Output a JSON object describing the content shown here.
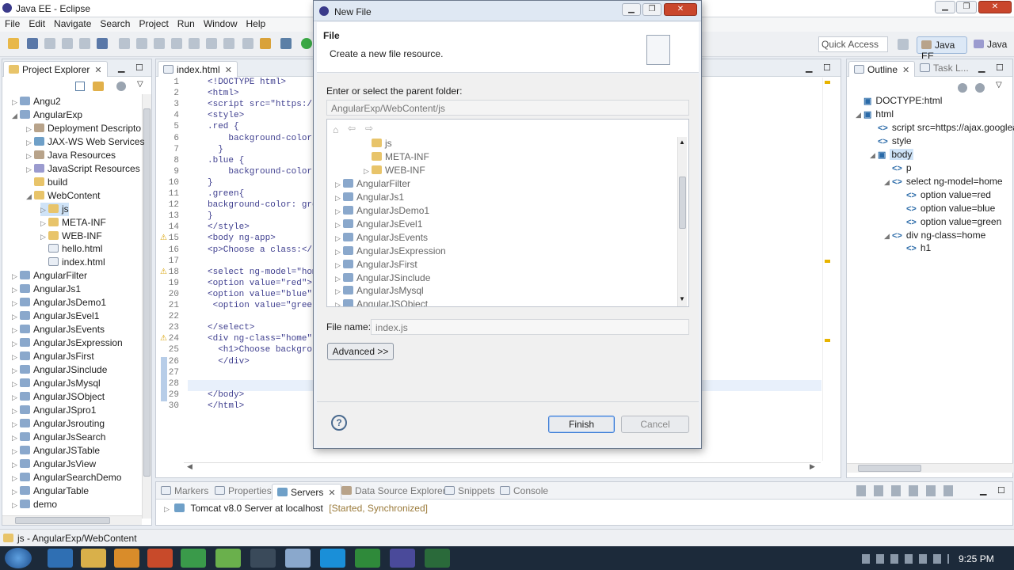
{
  "window": {
    "title": "Java EE - Eclipse"
  },
  "menu": [
    "File",
    "Edit",
    "Navigate",
    "Search",
    "Project",
    "Run",
    "Window",
    "Help"
  ],
  "toolbar": {
    "quick_access": "Quick Access",
    "persp_java_ee": "Java EE",
    "persp_java": "Java"
  },
  "explorer": {
    "tab": "Project Explorer",
    "rows": [
      {
        "label": "Angu2",
        "indent": 0,
        "tw": "▷",
        "icon": "proj"
      },
      {
        "label": "AngularExp",
        "indent": 0,
        "tw": "◢",
        "icon": "proj"
      },
      {
        "label": "Deployment Descripto",
        "indent": 1,
        "tw": "▷",
        "icon": "lib"
      },
      {
        "label": "JAX-WS Web Services",
        "indent": 1,
        "tw": "▷",
        "icon": "ws"
      },
      {
        "label": "Java Resources",
        "indent": 1,
        "tw": "▷",
        "icon": "lib"
      },
      {
        "label": "JavaScript Resources",
        "indent": 1,
        "tw": "▷",
        "icon": "js"
      },
      {
        "label": "build",
        "indent": 1,
        "tw": "",
        "icon": "folder"
      },
      {
        "label": "WebContent",
        "indent": 1,
        "tw": "◢",
        "icon": "folder"
      },
      {
        "label": "js",
        "indent": 2,
        "tw": "▷",
        "icon": "folder",
        "selected": true
      },
      {
        "label": "META-INF",
        "indent": 2,
        "tw": "▷",
        "icon": "folder"
      },
      {
        "label": "WEB-INF",
        "indent": 2,
        "tw": "▷",
        "icon": "folder"
      },
      {
        "label": "hello.html",
        "indent": 2,
        "tw": "",
        "icon": "file"
      },
      {
        "label": "index.html",
        "indent": 2,
        "tw": "",
        "icon": "file"
      },
      {
        "label": "AngularFilter",
        "indent": 0,
        "tw": "▷",
        "icon": "proj"
      },
      {
        "label": "AngularJs1",
        "indent": 0,
        "tw": "▷",
        "icon": "proj"
      },
      {
        "label": "AngularJsDemo1",
        "indent": 0,
        "tw": "▷",
        "icon": "proj"
      },
      {
        "label": "AngularJsEvel1",
        "indent": 0,
        "tw": "▷",
        "icon": "proj"
      },
      {
        "label": "AngularJsEvents",
        "indent": 0,
        "tw": "▷",
        "icon": "proj"
      },
      {
        "label": "AngularJsExpression",
        "indent": 0,
        "tw": "▷",
        "icon": "proj"
      },
      {
        "label": "AngularJsFirst",
        "indent": 0,
        "tw": "▷",
        "icon": "proj"
      },
      {
        "label": "AngularJSinclude",
        "indent": 0,
        "tw": "▷",
        "icon": "proj"
      },
      {
        "label": "AngularJsMysql",
        "indent": 0,
        "tw": "▷",
        "icon": "proj"
      },
      {
        "label": "AngularJSObject",
        "indent": 0,
        "tw": "▷",
        "icon": "proj"
      },
      {
        "label": "AngularJSpro1",
        "indent": 0,
        "tw": "▷",
        "icon": "proj"
      },
      {
        "label": "AngularJsrouting",
        "indent": 0,
        "tw": "▷",
        "icon": "proj"
      },
      {
        "label": "AngularJsSearch",
        "indent": 0,
        "tw": "▷",
        "icon": "proj"
      },
      {
        "label": "AngularJSTable",
        "indent": 0,
        "tw": "▷",
        "icon": "proj"
      },
      {
        "label": "AngularJsView",
        "indent": 0,
        "tw": "▷",
        "icon": "proj"
      },
      {
        "label": "AngularSearchDemo",
        "indent": 0,
        "tw": "▷",
        "icon": "proj"
      },
      {
        "label": "AngularTable",
        "indent": 0,
        "tw": "▷",
        "icon": "proj"
      },
      {
        "label": "demo",
        "indent": 0,
        "tw": "▷",
        "icon": "proj"
      }
    ]
  },
  "editor": {
    "tab": "index.html",
    "lines": [
      {
        "n": "1",
        "code": "<!DOCTYPE html>"
      },
      {
        "n": "2",
        "code": "<html>"
      },
      {
        "n": "3",
        "code": "<script src=\"https:/"
      },
      {
        "n": "4",
        "code": "<style>"
      },
      {
        "n": "5",
        "code": ".red {"
      },
      {
        "n": "6",
        "code": "    background-color"
      },
      {
        "n": "7",
        "code": "  }"
      },
      {
        "n": "8",
        "code": ".blue {"
      },
      {
        "n": "9",
        "code": "    background-color"
      },
      {
        "n": "10",
        "code": "}"
      },
      {
        "n": "11",
        "code": ".green{"
      },
      {
        "n": "12",
        "code": "background-color: gre"
      },
      {
        "n": "13",
        "code": "}"
      },
      {
        "n": "14",
        "code": "</style>"
      },
      {
        "n": "15",
        "code": "<body ng-app>",
        "warn": true
      },
      {
        "n": "16",
        "code": "<p>Choose a class:</"
      },
      {
        "n": "17",
        "code": ""
      },
      {
        "n": "18",
        "code": "<select ng-model=\"hom",
        "warn": true
      },
      {
        "n": "19",
        "code": "<option value=\"red\">"
      },
      {
        "n": "20",
        "code": "<option value=\"blue\""
      },
      {
        "n": "21",
        "code": " <option value=\"gree"
      },
      {
        "n": "22",
        "code": ""
      },
      {
        "n": "23",
        "code": "</select>"
      },
      {
        "n": "24",
        "code": "<div ng-class=\"home\"",
        "warn": true
      },
      {
        "n": "25",
        "code": "  <h1>Choose backgro"
      },
      {
        "n": "26",
        "code": "  </div>"
      },
      {
        "n": "27",
        "code": ""
      },
      {
        "n": "28",
        "code": ""
      },
      {
        "n": "29",
        "code": "</body>"
      },
      {
        "n": "30",
        "code": "</html>"
      }
    ]
  },
  "outline": {
    "tab": "Outline",
    "tab2": "Task L...",
    "rows": [
      {
        "label": "DOCTYPE:html",
        "indent": 0,
        "tw": "",
        "chev": "▣"
      },
      {
        "label": "html",
        "indent": 0,
        "tw": "◢",
        "chev": "▣"
      },
      {
        "label": "script src=https://ajax.googlea",
        "indent": 1,
        "tw": "",
        "chev": "<>"
      },
      {
        "label": "style",
        "indent": 1,
        "tw": "",
        "chev": "<>"
      },
      {
        "label": "body",
        "indent": 1,
        "tw": "◢",
        "chev": "▣",
        "selected": true
      },
      {
        "label": "p",
        "indent": 2,
        "tw": "",
        "chev": "<>"
      },
      {
        "label": "select ng-model=home",
        "indent": 2,
        "tw": "◢",
        "chev": "<>"
      },
      {
        "label": "option value=red",
        "indent": 3,
        "tw": "",
        "chev": "<>"
      },
      {
        "label": "option value=blue",
        "indent": 3,
        "tw": "",
        "chev": "<>"
      },
      {
        "label": "option value=green",
        "indent": 3,
        "tw": "",
        "chev": "<>"
      },
      {
        "label": "div ng-class=home",
        "indent": 2,
        "tw": "◢",
        "chev": "<>"
      },
      {
        "label": "h1",
        "indent": 3,
        "tw": "",
        "chev": "<>"
      }
    ]
  },
  "bottom": {
    "tabs": [
      "Markers",
      "Properties",
      "Servers",
      "Data Source Explorer",
      "Snippets",
      "Console"
    ],
    "server": "Tomcat v8.0 Server at localhost",
    "server_status": "[Started, Synchronized]"
  },
  "status": {
    "text": "js - AngularExp/WebContent"
  },
  "dialog": {
    "title": "New File",
    "heading": "File",
    "subheading": "Create a new file resource.",
    "parent_label": "Enter or select the parent folder:",
    "parent_value": "AngularExp/WebContent/js",
    "folders": [
      {
        "label": "js",
        "indent": 2,
        "tw": ""
      },
      {
        "label": "META-INF",
        "indent": 2,
        "tw": ""
      },
      {
        "label": "WEB-INF",
        "indent": 2,
        "tw": "▷"
      },
      {
        "label": "AngularFilter",
        "indent": 0,
        "tw": "▷"
      },
      {
        "label": "AngularJs1",
        "indent": 0,
        "tw": "▷"
      },
      {
        "label": "AngularJsDemo1",
        "indent": 0,
        "tw": "▷"
      },
      {
        "label": "AngularJsEvel1",
        "indent": 0,
        "tw": "▷"
      },
      {
        "label": "AngularJsEvents",
        "indent": 0,
        "tw": "▷"
      },
      {
        "label": "AngularJsExpression",
        "indent": 0,
        "tw": "▷"
      },
      {
        "label": "AngularJsFirst",
        "indent": 0,
        "tw": "▷"
      },
      {
        "label": "AngularJSinclude",
        "indent": 0,
        "tw": "▷"
      },
      {
        "label": "AngularJsMysql",
        "indent": 0,
        "tw": "▷"
      },
      {
        "label": "AngularJSObject",
        "indent": 0,
        "tw": "▷"
      }
    ],
    "filename_label": "File name:",
    "filename_value": "index.js",
    "advanced": "Advanced >>",
    "finish": "Finish",
    "cancel": "Cancel",
    "help": "?"
  },
  "clock": {
    "time": "9:25 PM"
  }
}
